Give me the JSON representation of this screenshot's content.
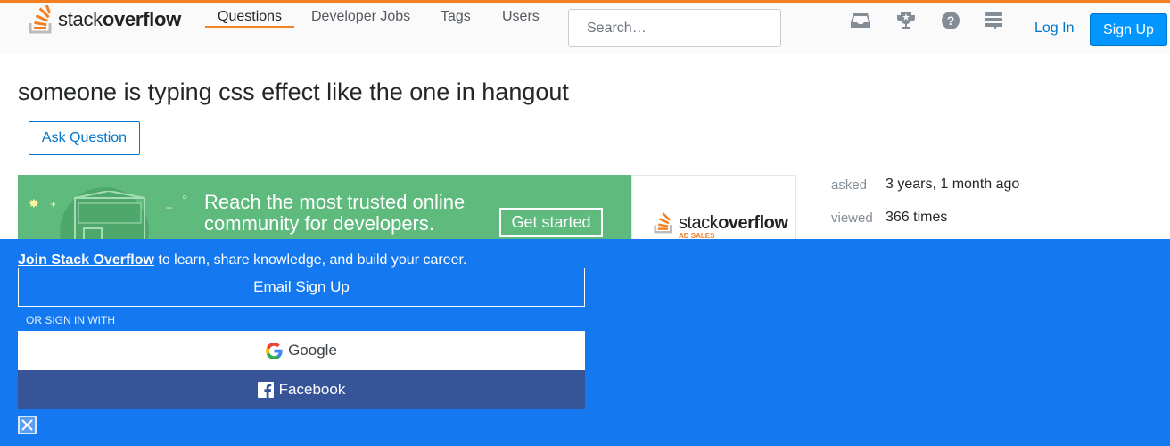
{
  "header": {
    "logo": {
      "icon": "stackoverflow-logo-icon",
      "text_regular": "stack",
      "text_bold": "overflow"
    },
    "nav": [
      {
        "label": "Questions",
        "active": true
      },
      {
        "label": "Developer Jobs",
        "active": false
      },
      {
        "label": "Tags",
        "active": false
      },
      {
        "label": "Users",
        "active": false
      }
    ],
    "search": {
      "placeholder": "Search…"
    },
    "icons": [
      "inbox-icon",
      "trophy-icon",
      "help-icon",
      "site-switcher-icon"
    ],
    "login_label": "Log In",
    "signup_label": "Sign Up",
    "accent_color": "#f48024",
    "link_color": "#0077cc"
  },
  "question": {
    "title": "someone is typing css effect like the one in hangout",
    "ask_button": "Ask Question"
  },
  "ad": {
    "line1": "Reach the most trusted online",
    "line2": "community for developers.",
    "cta": "Get started",
    "brand_regular": "stack",
    "brand_bold": "overflow",
    "brand_sub": "AD SALES",
    "background_color": "#5eba7d"
  },
  "meta": {
    "asked_label": "asked",
    "asked_value": "3 years, 1 month ago",
    "viewed_label": "viewed",
    "viewed_value": "366 times"
  },
  "signup_overlay": {
    "join_bold": "Join Stack Overflow",
    "join_rest": " to learn, share knowledge, and build your career.",
    "email_button": "Email Sign Up",
    "or_text": "OR SIGN IN WITH",
    "google_button": "Google",
    "facebook_button": "Facebook",
    "background_color": "#1479f1"
  }
}
